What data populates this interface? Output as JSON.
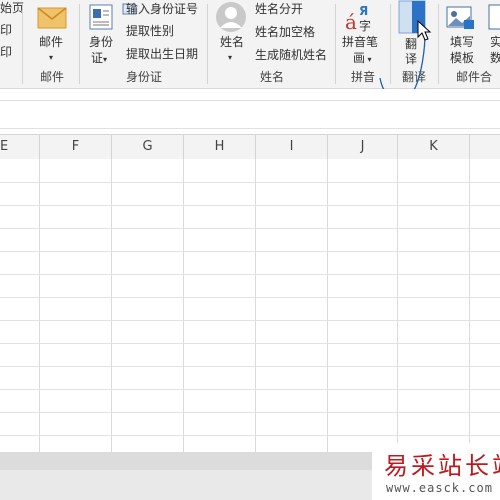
{
  "ribbon": {
    "left_partial": {
      "item1": "始页",
      "item2": "印",
      "item3": "印"
    },
    "mail": {
      "button_label": "邮件",
      "group_label": "邮件"
    },
    "idcard": {
      "button_label_line1": "身份",
      "button_label_line2": "证",
      "items": [
        "输入身份证号",
        "提取性别",
        "提取出生日期"
      ],
      "group_label": "身份证"
    },
    "name": {
      "button_label": "姓名",
      "items": [
        "姓名分开",
        "姓名加空格",
        "生成随机姓名"
      ],
      "group_label": "姓名"
    },
    "pinyin": {
      "icon_glyph_a": "á",
      "icon_glyph_ya": "Я",
      "icon_glyph_zi": "字",
      "button_label_line1": "拼音笔",
      "button_label_line2": "画",
      "group_label": "拼音"
    },
    "translate": {
      "button_label_line1": "翻",
      "button_label_line2": "译",
      "group_label": "翻译"
    },
    "mailmerge": {
      "button_label_line1": "填写",
      "button_label_line2": "模板",
      "partial_line1": "实",
      "partial_line2": "数",
      "group_label": "邮件合"
    }
  },
  "columns": [
    "E",
    "F",
    "G",
    "H",
    "I",
    "J",
    "K"
  ],
  "watermark": {
    "text": "易采站长站",
    "url": "www.easck.com"
  },
  "colors": {
    "accent_blue": "#2b73c6",
    "watermark_red": "#c0181e",
    "envelope": "#f0c36a"
  }
}
